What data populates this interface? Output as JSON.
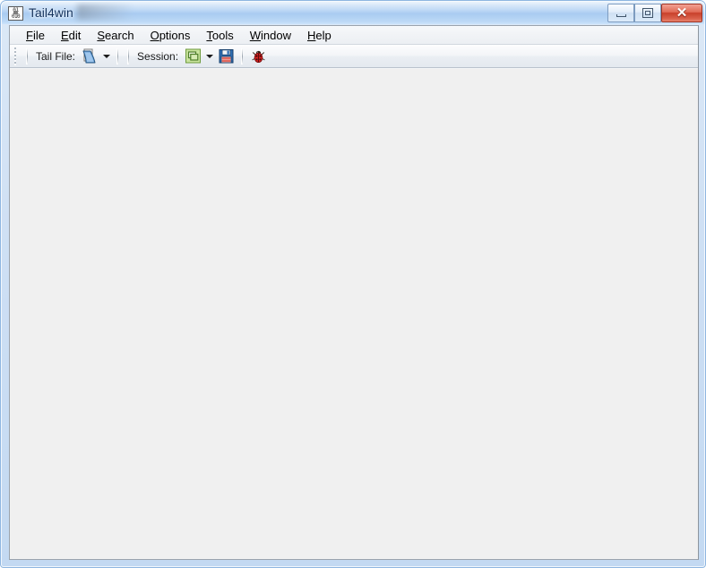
{
  "window": {
    "title": "Tail4win",
    "icon_name": "binary-page-icon",
    "icon_text_top": "01",
    "icon_text_bottom": "010",
    "title_redacted": true,
    "controls": {
      "minimize_label": "Minimize",
      "maximize_label": "Restore",
      "close_label": "Close",
      "close_glyph": "✕"
    },
    "frame_color": "#c3d9f2",
    "titlebar_color": "#b0d0f3",
    "close_button_color": "#c8402b"
  },
  "menubar": {
    "items": [
      {
        "label": "File",
        "accel": "F"
      },
      {
        "label": "Edit",
        "accel": "E"
      },
      {
        "label": "Search",
        "accel": "S"
      },
      {
        "label": "Options",
        "accel": "O"
      },
      {
        "label": "Tools",
        "accel": "T"
      },
      {
        "label": "Window",
        "accel": "W"
      },
      {
        "label": "Help",
        "accel": "H"
      }
    ]
  },
  "toolbar": {
    "grip_name": "toolbar-drag-grip",
    "tail_file_label": "Tail File:",
    "tail_file_icon": "open-log-file-icon",
    "tail_file_dropdown_icon": "chevron-down-icon",
    "session_label": "Session:",
    "session_open_icon": "open-session-icon",
    "session_dropdown_icon": "chevron-down-icon",
    "session_save_icon": "save-floppy-icon",
    "debug_icon": "ladybug-icon",
    "accent_green": "#6cab3c",
    "accent_save_blue": "#2f6fb5",
    "accent_bug_red": "#cc2222"
  },
  "content": {
    "text": "",
    "background": "#f0f0f0"
  }
}
